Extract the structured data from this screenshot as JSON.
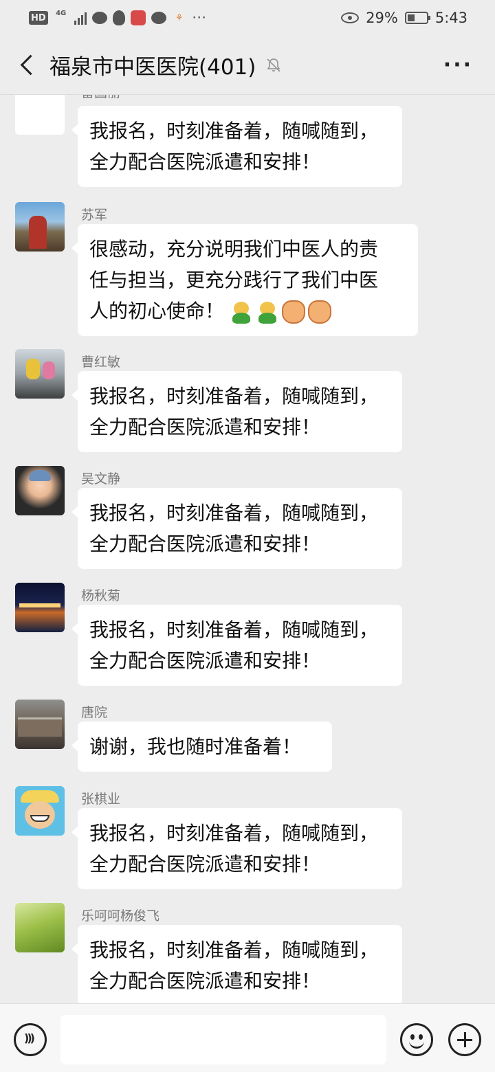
{
  "status_bar": {
    "hd": "HD",
    "network": "4G",
    "battery_percent": "29%",
    "time": "5:43"
  },
  "header": {
    "title": "福泉市中医医院(401)",
    "more_label": "···"
  },
  "messages": [
    {
      "sender": "雷国丽",
      "lines": [
        "我报名，时刻准备着，随喊随到，",
        "全力配合医院派遣和安排！"
      ]
    },
    {
      "sender": "苏军",
      "lines": [
        "很感动，充分说明我们中医人的责",
        "任与担当，更充分践行了我们中医",
        "人的初心使命！"
      ],
      "emojis": [
        "sprout",
        "sprout",
        "fist",
        "fist"
      ]
    },
    {
      "sender": "曹红敏",
      "lines": [
        "我报名，时刻准备着，随喊随到，",
        "全力配合医院派遣和安排！"
      ]
    },
    {
      "sender": "吴文静",
      "lines": [
        "我报名，时刻准备着，随喊随到，",
        "全力配合医院派遣和安排！"
      ]
    },
    {
      "sender": "杨秋菊",
      "lines": [
        "我报名，时刻准备着，随喊随到，",
        "全力配合医院派遣和安排！"
      ]
    },
    {
      "sender": "唐院",
      "lines": [
        "谢谢，我也随时准备着！"
      ]
    },
    {
      "sender": "张棋业",
      "lines": [
        "我报名，时刻准备着，随喊随到，",
        "全力配合医院派遣和安排！"
      ]
    },
    {
      "sender": "乐呵呵杨俊飞",
      "lines": [
        "我报名，时刻准备着，随喊随到，",
        "全力配合医院派遣和安排！"
      ]
    }
  ],
  "input_bar": {
    "voice_icon": "voice-icon",
    "emoji_icon": "emoji-icon",
    "plus_icon": "plus-icon"
  }
}
